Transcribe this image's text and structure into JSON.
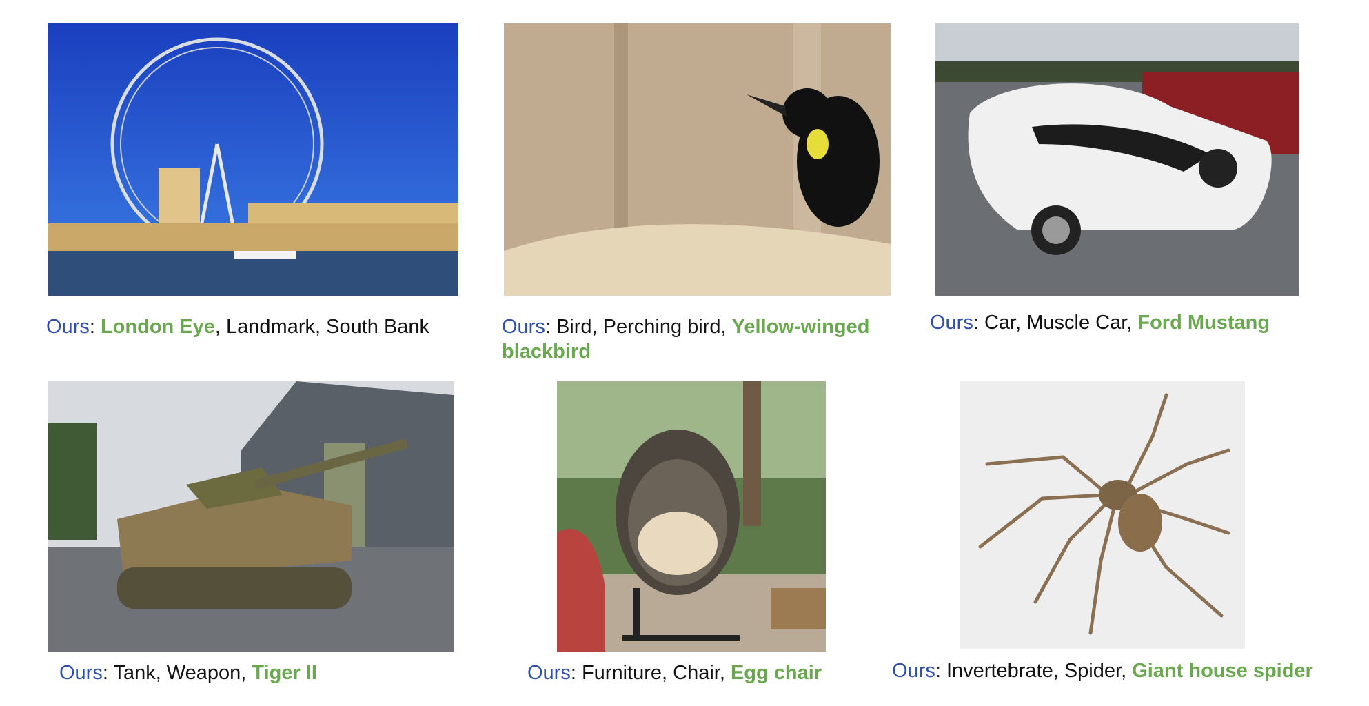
{
  "figures": [
    {
      "image_name": "london-eye-photo",
      "caption": {
        "prefix": "Ours",
        "sep": ": ",
        "terms": [
          "London Eye",
          ", ",
          "Landmark, South Bank"
        ]
      }
    },
    {
      "image_name": "blackbird-photo",
      "caption": {
        "prefix": "Ours",
        "sep": ": ",
        "terms": [
          "Bird, Perching bird, ",
          "Yellow-winged blackbird"
        ]
      }
    },
    {
      "image_name": "mustang-photo",
      "caption": {
        "prefix": "Ours",
        "sep": ": ",
        "terms": [
          "Car, Muscle Car, ",
          "Ford Mustang"
        ]
      }
    },
    {
      "image_name": "tank-photo",
      "caption": {
        "prefix": "Ours",
        "sep": ": ",
        "terms": [
          "Tank, Weapon, ",
          "Tiger II"
        ]
      }
    },
    {
      "image_name": "egg-chair-photo",
      "caption": {
        "prefix": "Ours",
        "sep": ": ",
        "terms": [
          "Furniture, Chair, ",
          "Egg chair"
        ]
      }
    },
    {
      "image_name": "spider-photo",
      "caption": {
        "prefix": "Ours",
        "sep": ": ",
        "terms": [
          "Invertebrate, Spider, ",
          "Giant house spider"
        ]
      }
    }
  ],
  "colors": {
    "ours": "#2f4fb0",
    "highlight": "#6aa84f",
    "text": "#111111"
  }
}
